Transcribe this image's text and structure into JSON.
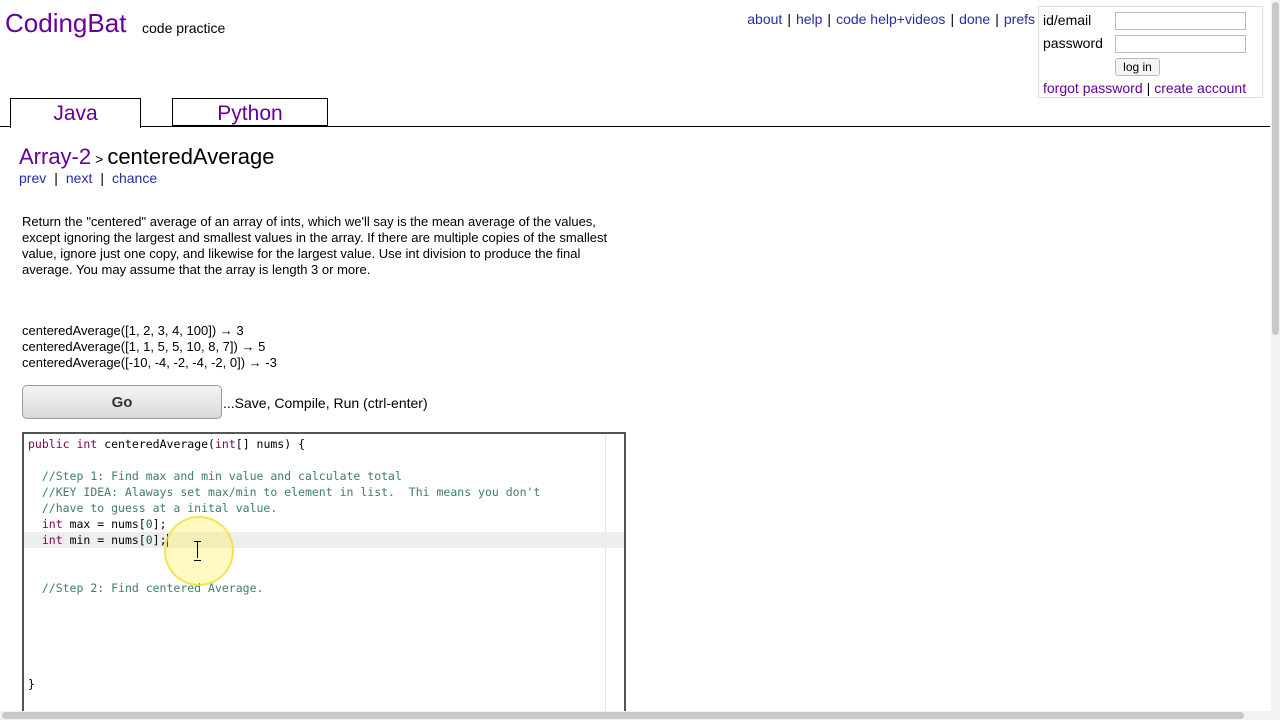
{
  "header": {
    "logo": "CodingBat",
    "tagline": "code practice",
    "nav": [
      {
        "label": "about"
      },
      {
        "label": "help"
      },
      {
        "label": "code help+videos"
      },
      {
        "label": "done"
      },
      {
        "label": "prefs"
      }
    ]
  },
  "login": {
    "id_label": "id/email",
    "password_label": "password",
    "login_button": "log in",
    "forgot_link": "forgot password",
    "create_link": "create account"
  },
  "tabs": [
    {
      "label": "Java",
      "active": true
    },
    {
      "label": "Python",
      "active": false
    }
  ],
  "breadcrumb": {
    "section": "Array-2",
    "separator": ">",
    "problem": "centeredAverage"
  },
  "problem_nav": {
    "prev": "prev",
    "next": "next",
    "chance": "chance"
  },
  "description": "Return the \"centered\" average of an array of ints, which we'll say is the mean average of the values, except ignoring the largest and smallest values in the array. If there are multiple copies of the smallest value, ignore just one copy, and likewise for the largest value. Use int division to produce the final average. You may assume that the array is length 3 or more.",
  "examples": [
    "centeredAverage([1, 2, 3, 4, 100]) → 3",
    "centeredAverage([1, 1, 5, 5, 10, 8, 7]) → 5",
    "centeredAverage([-10, -4, -2, -4, -2, 0]) → -3"
  ],
  "go_button": "Go",
  "go_note": "...Save, Compile, Run (ctrl-enter)",
  "code": {
    "signature_kw1": "public",
    "signature_kw2": "int",
    "signature_name": "centeredAverage(",
    "signature_param_kw": "int",
    "signature_rest": "[] nums) {",
    "comment1": "//Step 1: Find max and min value and calculate total",
    "comment2": "//KEY IDEA: Alaways set max/min to element in list.  Thi means you don't",
    "comment3": "//have to guess at a inital value.",
    "max_kw": "int",
    "max_rest_a": " max = nums[",
    "max_idx": "0",
    "max_rest_b": "];",
    "min_kw": "int",
    "min_rest_a": " min = nums[",
    "min_idx": "0",
    "min_rest_b": "];",
    "comment4": "//Step 2: Find centered Average.",
    "close": "}"
  }
}
